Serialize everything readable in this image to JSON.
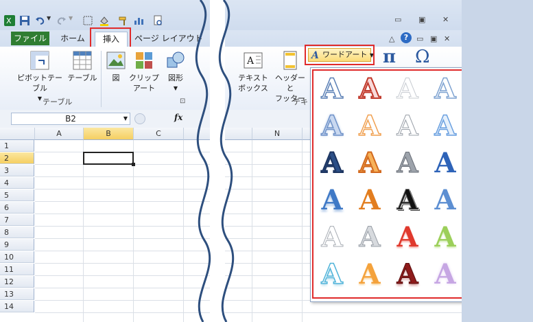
{
  "quick_access": {
    "excel_icon": "excel-icon",
    "save_icon": "save-icon",
    "undo_icon": "undo-icon",
    "redo_icon": "redo-icon"
  },
  "tabs": {
    "file": "ファイル",
    "home": "ホーム",
    "insert": "挿入",
    "page_layout": "ページ レイアウト"
  },
  "ribbon": {
    "pivot_table": "ピボットテーブル",
    "table": "テーブル",
    "group_table": "テーブル",
    "picture": "図",
    "clip_art_line1": "クリップ",
    "clip_art_line2": "アート",
    "shapes": "図形",
    "text_box_line1": "テキスト",
    "text_box_line2": "ボックス",
    "header_footer_line1": "ヘッダーと",
    "header_footer_line2": "フッター",
    "group_text_partial": "テキ",
    "wordart": "ワードアート",
    "equation_symbol": "π",
    "symbol_symbol": "Ω"
  },
  "formula_bar": {
    "name_box": "B2",
    "fx": "fx"
  },
  "grid": {
    "columns_left": [
      "A",
      "B",
      "C"
    ],
    "column_right": "N",
    "rows": [
      "1",
      "2",
      "3",
      "4",
      "5",
      "6",
      "7",
      "8",
      "9",
      "10",
      "11",
      "12",
      "13",
      "14"
    ],
    "selected_cell": "B2"
  },
  "wordart_gallery": {
    "glyph": "A",
    "styles": [
      [
        "outline-blue",
        "red-outline",
        "pale-outline",
        "blue-outline",
        "green-fill"
      ],
      [
        "blue-glow",
        "orange-outline",
        "gray-outline",
        "light-blue-outline",
        "pale-green"
      ],
      [
        "navy-bevel",
        "orange-bevel",
        "silver-gradient",
        "blue-bold",
        "red-striped"
      ],
      [
        "blue-reflect",
        "orange-bold",
        "black-outline",
        "blue-gradient",
        "purple-bold"
      ],
      [
        "white-gray",
        "silver-soft",
        "red-shine",
        "green-shine",
        "blue-3d"
      ],
      [
        "cyan-outline",
        "orange-shine",
        "red-dark",
        "lilac-soft",
        "navy-3d"
      ]
    ]
  },
  "colors": {
    "highlight_red": "#e02a2a",
    "ribbon_blue": "#dbe5f3",
    "file_tab_green": "#2f7d32",
    "wavy_line": "#2e4f7e"
  }
}
